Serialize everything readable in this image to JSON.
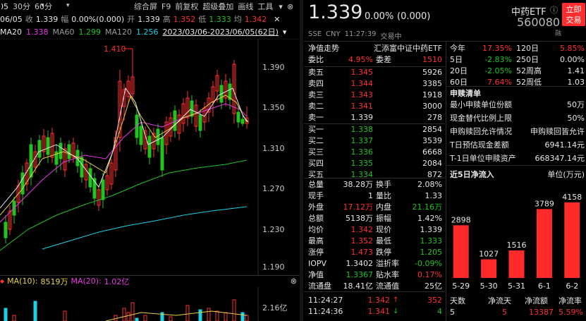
{
  "toolbar": {
    "date_fragment": "06/05",
    "periods": [
      "30分",
      "60分"
    ],
    "check_label": "收",
    "view_items": [
      "综合屏",
      "F9",
      "前复权",
      "超级叠加",
      "画线",
      "工具"
    ],
    "ohlc": {
      "close_label": "收",
      "close": "1.339",
      "change_label": "幅",
      "change": "0.00%(0.000)",
      "open_label": "开",
      "open": "1.339",
      "high_label": "高",
      "high": "1.352",
      "low_label": "低",
      "low": "1.333",
      "prev_label": "均",
      "prev": "1.342"
    }
  },
  "ma_row": {
    "ma20_label": "MA20",
    "ma20": "1.338",
    "ma60_label": "MA60",
    "ma60": "1.299",
    "ma120_label": "MA120",
    "ma120": "1.256",
    "range": "2023/03/06-2023/06/05(62日)"
  },
  "price_axis": [
    "1.390",
    "1.350",
    "1.310",
    "1.270",
    "1.230",
    "1.190"
  ],
  "peak_label": "1.410",
  "volume_panel": {
    "ma10_label": "MA(10):",
    "ma10": "8519万",
    "ma20_label": "MA(20):",
    "ma20": "1.02亿",
    "axis_top": "2.16亿"
  },
  "quote": {
    "price": "1.339",
    "change": "0.00%",
    "change_abs": "(0.000)",
    "name": "中药ETF",
    "code": "560080",
    "flag": "融",
    "exchange": "SSE",
    "currency": "CNY",
    "time": "11:27:39",
    "status": "交易中",
    "button_1": "立即",
    "button_2": "交易"
  },
  "info": {
    "trend_label": "净值走势",
    "fund_name": "汇添富中证中药ETF",
    "ratio_label": "委比",
    "ratio": "4.95%",
    "diff_label": "委差",
    "diff": "1510"
  },
  "asks": [
    {
      "label": "卖五",
      "price": "1.345",
      "vol": "5926"
    },
    {
      "label": "卖四",
      "price": "1.344",
      "vol": "3385"
    },
    {
      "label": "卖三",
      "price": "1.343",
      "vol": "1918"
    },
    {
      "label": "卖二",
      "price": "1.341",
      "vol": "3000"
    },
    {
      "label": "卖一",
      "price": "1.339",
      "vol": "278"
    }
  ],
  "bids": [
    {
      "label": "买一",
      "price": "1.338",
      "vol": "2854"
    },
    {
      "label": "买二",
      "price": "1.337",
      "vol": "3539"
    },
    {
      "label": "买三",
      "price": "1.336",
      "vol": "6668"
    },
    {
      "label": "买四",
      "price": "1.335",
      "vol": "2084"
    },
    {
      "label": "买五",
      "price": "1.334",
      "vol": "872"
    }
  ],
  "stats": [
    {
      "l1": "总量",
      "v1": "38.28万",
      "c1": "white",
      "l2": "换手",
      "v2": "2.08%",
      "c2": "white"
    },
    {
      "l1": "现手",
      "v1": "1",
      "c1": "white",
      "l2": "量比",
      "v2": "1.33",
      "c2": "white"
    },
    {
      "l1": "外盘",
      "v1": "17.12万",
      "c1": "red",
      "l2": "内盘",
      "v2": "21.16万",
      "c2": "green"
    },
    {
      "l1": "总额",
      "v1": "5138万",
      "c1": "white",
      "l2": "振幅",
      "v2": "1.42%",
      "c2": "white"
    },
    {
      "l1": "均价",
      "v1": "1.342",
      "c1": "red",
      "l2": "现价",
      "v2": "1.339",
      "c2": "white"
    },
    {
      "l1": "最高",
      "v1": "1.352",
      "c1": "red",
      "l2": "最低",
      "v2": "1.333",
      "c2": "green"
    },
    {
      "l1": "涨停",
      "v1": "1.473",
      "c1": "red",
      "l2": "跌停",
      "v2": "1.205",
      "c2": "green"
    },
    {
      "l1": "IOPV",
      "v1": "1.3402",
      "c1": "white",
      "l2": "溢折率",
      "v2": "-0.09%",
      "c2": "green"
    },
    {
      "l1": "净值",
      "v1": "1.3367",
      "c1": "green",
      "l2": "贴水率",
      "v2": "0.17%",
      "c2": "red"
    },
    {
      "l1": "流通盘",
      "v1": "18.41亿",
      "c1": "white",
      "l2": "流通值",
      "v2": "25亿",
      "c2": "white"
    }
  ],
  "ticks": [
    {
      "time": "11:24:27",
      "price": "1.342",
      "arrow": "↑",
      "vol": "352",
      "pc": "red",
      "vc": "red"
    },
    {
      "time": "11:24:36",
      "price": "1.341",
      "arrow": "↓",
      "vol": "4",
      "pc": "red",
      "vc": "green"
    }
  ],
  "perf": [
    {
      "l1": "今年",
      "v1": "17.35%",
      "c1": "red",
      "l2": "120日",
      "v2": "5.85%",
      "c2": "red"
    },
    {
      "l1": "5日",
      "v1": "-2.83%",
      "c1": "green",
      "l2": "250日",
      "v2": "0.00%",
      "c2": "white"
    },
    {
      "l1": "20日",
      "v1": "-2.05%",
      "c1": "green",
      "l2": "52周高",
      "v2": "1.41",
      "c2": "white"
    },
    {
      "l1": "60日",
      "v1": "7.64%",
      "c1": "red",
      "l2": "52周低",
      "v2": "1.03",
      "c2": "white"
    }
  ],
  "redemption": {
    "title": "申赎清单",
    "rows": [
      {
        "label": "最小申赎单位份额",
        "value": "50万"
      },
      {
        "label": "现金替代比例上限",
        "value": "50%"
      },
      {
        "label": "申购赎回允许情况",
        "value": "申购赎回皆允许"
      },
      {
        "label": "T日预估现金差额",
        "value": "6941.14元"
      },
      {
        "label": "T-1日单位申赎资产",
        "value": "668347.14元"
      }
    ]
  },
  "inflow": {
    "title": "近5日净流入",
    "unit": "单位(万元)",
    "footer_labels": [
      "天数",
      "净流天",
      "净流额",
      "净流率"
    ],
    "footer_values": [
      "5",
      "5",
      "13387",
      "5.59%"
    ]
  },
  "chart_data": {
    "type": "bar",
    "title": "近5日净流入",
    "ylabel": "单位(万元)",
    "categories": [
      "5-29",
      "5-30",
      "5-31",
      "6-1",
      "6-2"
    ],
    "values": [
      2898,
      1027,
      1516,
      3789,
      4158
    ],
    "ylim": [
      0,
      4500
    ]
  },
  "colors": {
    "up": "#ff3030",
    "down": "#21c321",
    "ma5": "#e6e6e6",
    "ma10": "#e8d24a",
    "ma20": "#e838e8",
    "ma60": "#21c321",
    "ma120": "#1bd1e6"
  }
}
